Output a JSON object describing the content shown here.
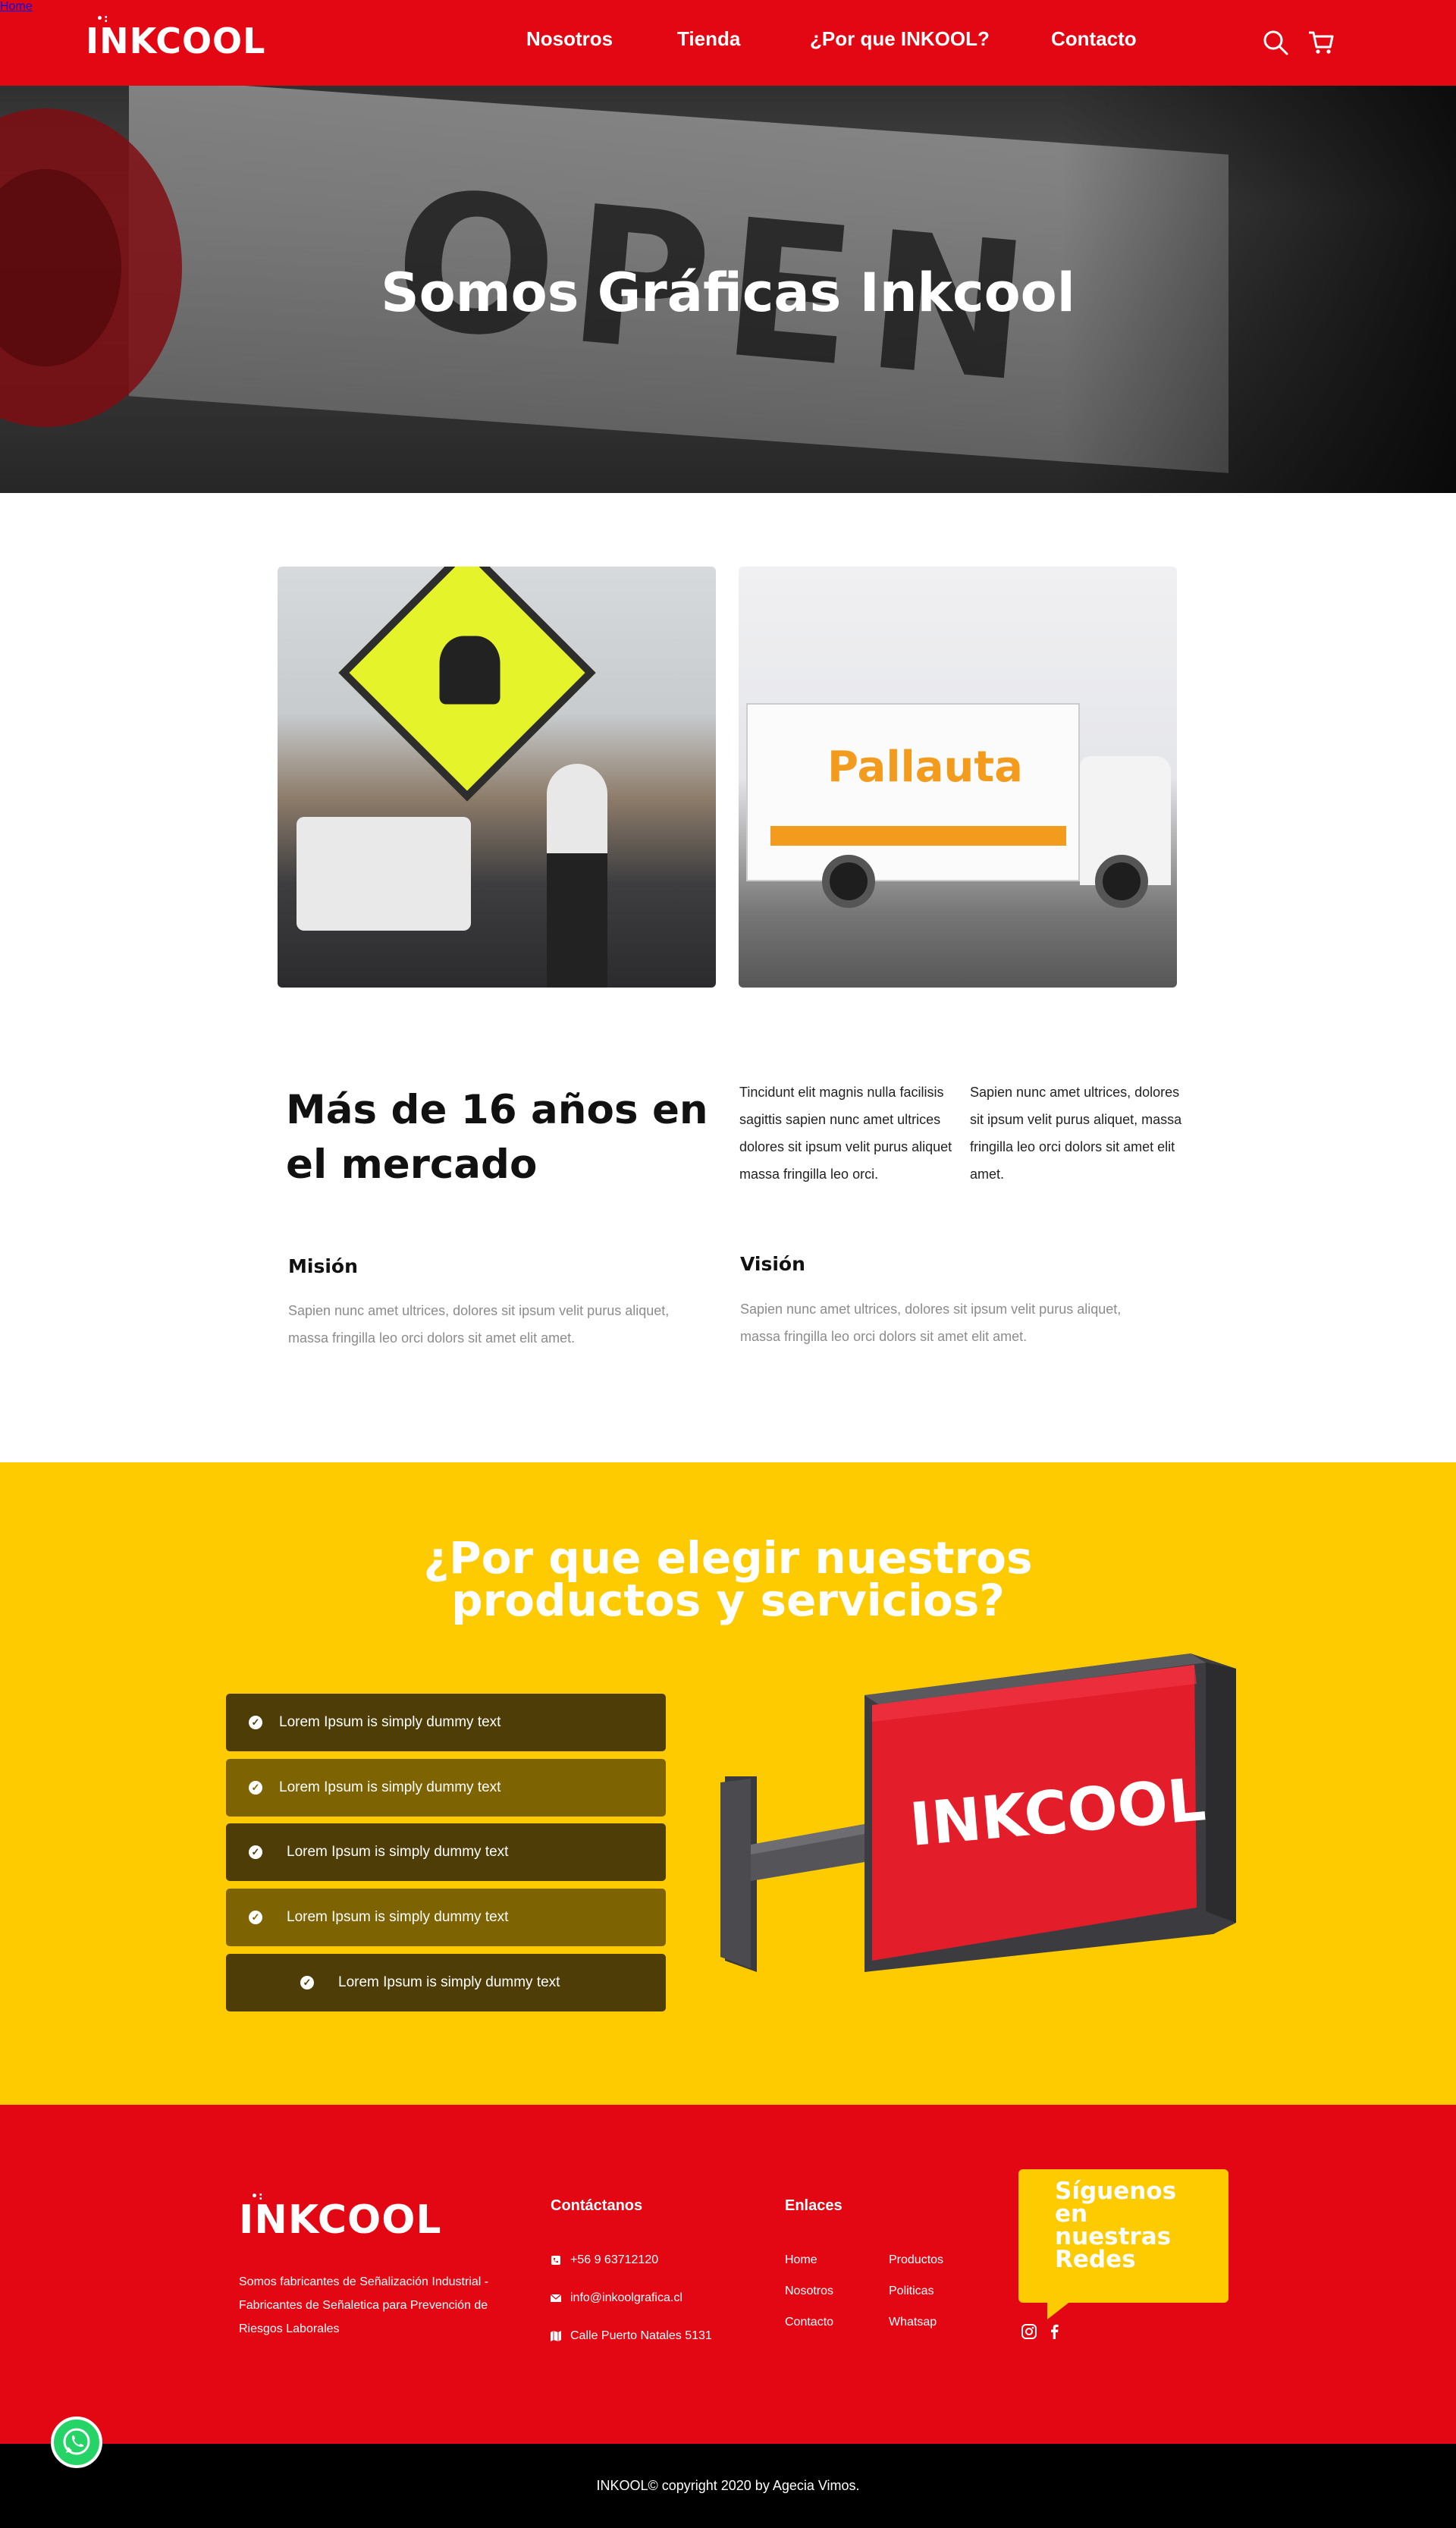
{
  "header": {
    "logo": "INKCOOL",
    "nav": [
      "Home",
      "Nosotros",
      "Tienda",
      "¿Por que INKOOL?",
      "Contacto"
    ],
    "icons": [
      "search-icon",
      "cart-icon"
    ]
  },
  "hero": {
    "title": "Somos Gráficas Inkcool"
  },
  "photos": {
    "truck_brand": "Pallauta"
  },
  "about": {
    "title": "Más de 16 años en el mercado",
    "col1": "Tincidunt elit magnis nulla facilisis sagittis sapien nunc amet ultrices dolores sit ipsum velit purus aliquet massa fringilla leo orci.",
    "col2": "Sapien nunc amet ultrices, dolores sit ipsum velit purus aliquet, massa fringilla leo orci dolors sit amet elit amet.",
    "mision_title": "Misión",
    "mision_text": "Sapien nunc amet ultrices, dolores sit ipsum velit purus aliquet, massa fringilla leo orci dolors sit amet elit amet.",
    "vision_title": "Visión",
    "vision_text": "Sapien nunc amet ultrices, dolores sit ipsum velit purus aliquet, massa fringilla leo orci dolors sit amet elit amet."
  },
  "why": {
    "title": "¿Por que elegir nuestros productos y servicios?",
    "items": [
      "Lorem Ipsum is simply dummy text",
      "Lorem Ipsum is simply dummy text",
      "Lorem Ipsum is simply dummy text",
      "Lorem Ipsum is simply dummy text",
      "Lorem Ipsum is simply dummy text"
    ],
    "sign_text": "INKCOOL"
  },
  "footer": {
    "logo": "INKCOOL",
    "description": "Somos fabricantes de Señalización Industrial - Fabricantes de Señaletica para Prevención de Riesgos Laborales",
    "contact_title": "Contáctanos",
    "phone": "+56 9 63712120",
    "email": "info@inkoolgrafica.cl",
    "address": "Calle Puerto Natales 5131",
    "links_title": "Enlaces",
    "links_col1": [
      "Home",
      "Nosotros",
      "Contacto"
    ],
    "links_col2": [
      "Productos",
      "Politicas",
      "Whatsap"
    ],
    "follow": "Síguenos en nuestras Redes",
    "social": [
      "instagram-icon",
      "facebook-icon"
    ]
  },
  "copyright": "INKOOL© copyright 2020 by Agecia Vimos.",
  "colors": {
    "brand_red": "#e30613",
    "brand_yellow": "#fecb00",
    "feature_dark": "#4e3d06",
    "feature_light": "#7e6302"
  }
}
